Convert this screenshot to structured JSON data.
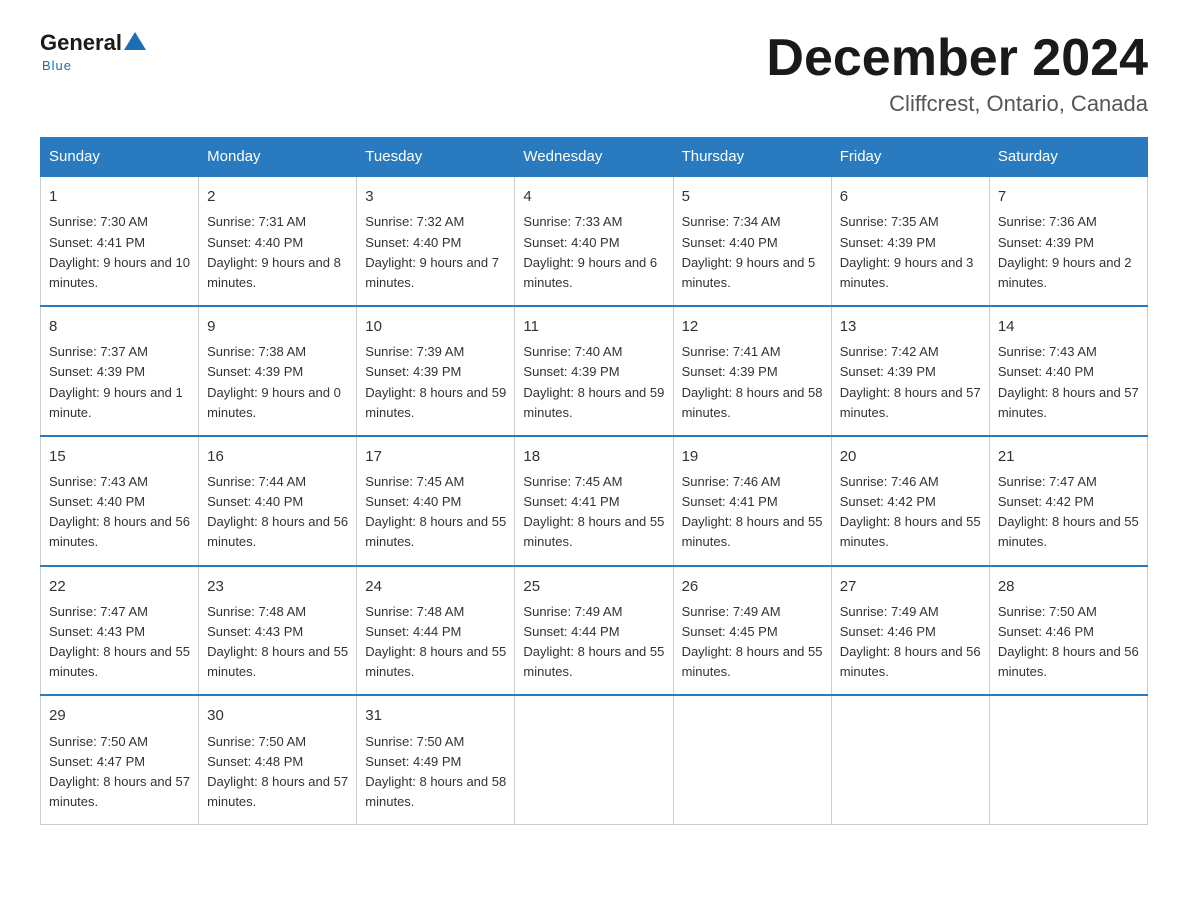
{
  "logo": {
    "general": "General",
    "blue": "Blue",
    "underline": "Blue"
  },
  "title": "December 2024",
  "subtitle": "Cliffcrest, Ontario, Canada",
  "days_of_week": [
    "Sunday",
    "Monday",
    "Tuesday",
    "Wednesday",
    "Thursday",
    "Friday",
    "Saturday"
  ],
  "weeks": [
    [
      {
        "day": "1",
        "sunrise": "7:30 AM",
        "sunset": "4:41 PM",
        "daylight": "9 hours and 10 minutes."
      },
      {
        "day": "2",
        "sunrise": "7:31 AM",
        "sunset": "4:40 PM",
        "daylight": "9 hours and 8 minutes."
      },
      {
        "day": "3",
        "sunrise": "7:32 AM",
        "sunset": "4:40 PM",
        "daylight": "9 hours and 7 minutes."
      },
      {
        "day": "4",
        "sunrise": "7:33 AM",
        "sunset": "4:40 PM",
        "daylight": "9 hours and 6 minutes."
      },
      {
        "day": "5",
        "sunrise": "7:34 AM",
        "sunset": "4:40 PM",
        "daylight": "9 hours and 5 minutes."
      },
      {
        "day": "6",
        "sunrise": "7:35 AM",
        "sunset": "4:39 PM",
        "daylight": "9 hours and 3 minutes."
      },
      {
        "day": "7",
        "sunrise": "7:36 AM",
        "sunset": "4:39 PM",
        "daylight": "9 hours and 2 minutes."
      }
    ],
    [
      {
        "day": "8",
        "sunrise": "7:37 AM",
        "sunset": "4:39 PM",
        "daylight": "9 hours and 1 minute."
      },
      {
        "day": "9",
        "sunrise": "7:38 AM",
        "sunset": "4:39 PM",
        "daylight": "9 hours and 0 minutes."
      },
      {
        "day": "10",
        "sunrise": "7:39 AM",
        "sunset": "4:39 PM",
        "daylight": "8 hours and 59 minutes."
      },
      {
        "day": "11",
        "sunrise": "7:40 AM",
        "sunset": "4:39 PM",
        "daylight": "8 hours and 59 minutes."
      },
      {
        "day": "12",
        "sunrise": "7:41 AM",
        "sunset": "4:39 PM",
        "daylight": "8 hours and 58 minutes."
      },
      {
        "day": "13",
        "sunrise": "7:42 AM",
        "sunset": "4:39 PM",
        "daylight": "8 hours and 57 minutes."
      },
      {
        "day": "14",
        "sunrise": "7:43 AM",
        "sunset": "4:40 PM",
        "daylight": "8 hours and 57 minutes."
      }
    ],
    [
      {
        "day": "15",
        "sunrise": "7:43 AM",
        "sunset": "4:40 PM",
        "daylight": "8 hours and 56 minutes."
      },
      {
        "day": "16",
        "sunrise": "7:44 AM",
        "sunset": "4:40 PM",
        "daylight": "8 hours and 56 minutes."
      },
      {
        "day": "17",
        "sunrise": "7:45 AM",
        "sunset": "4:40 PM",
        "daylight": "8 hours and 55 minutes."
      },
      {
        "day": "18",
        "sunrise": "7:45 AM",
        "sunset": "4:41 PM",
        "daylight": "8 hours and 55 minutes."
      },
      {
        "day": "19",
        "sunrise": "7:46 AM",
        "sunset": "4:41 PM",
        "daylight": "8 hours and 55 minutes."
      },
      {
        "day": "20",
        "sunrise": "7:46 AM",
        "sunset": "4:42 PM",
        "daylight": "8 hours and 55 minutes."
      },
      {
        "day": "21",
        "sunrise": "7:47 AM",
        "sunset": "4:42 PM",
        "daylight": "8 hours and 55 minutes."
      }
    ],
    [
      {
        "day": "22",
        "sunrise": "7:47 AM",
        "sunset": "4:43 PM",
        "daylight": "8 hours and 55 minutes."
      },
      {
        "day": "23",
        "sunrise": "7:48 AM",
        "sunset": "4:43 PM",
        "daylight": "8 hours and 55 minutes."
      },
      {
        "day": "24",
        "sunrise": "7:48 AM",
        "sunset": "4:44 PM",
        "daylight": "8 hours and 55 minutes."
      },
      {
        "day": "25",
        "sunrise": "7:49 AM",
        "sunset": "4:44 PM",
        "daylight": "8 hours and 55 minutes."
      },
      {
        "day": "26",
        "sunrise": "7:49 AM",
        "sunset": "4:45 PM",
        "daylight": "8 hours and 55 minutes."
      },
      {
        "day": "27",
        "sunrise": "7:49 AM",
        "sunset": "4:46 PM",
        "daylight": "8 hours and 56 minutes."
      },
      {
        "day": "28",
        "sunrise": "7:50 AM",
        "sunset": "4:46 PM",
        "daylight": "8 hours and 56 minutes."
      }
    ],
    [
      {
        "day": "29",
        "sunrise": "7:50 AM",
        "sunset": "4:47 PM",
        "daylight": "8 hours and 57 minutes."
      },
      {
        "day": "30",
        "sunrise": "7:50 AM",
        "sunset": "4:48 PM",
        "daylight": "8 hours and 57 minutes."
      },
      {
        "day": "31",
        "sunrise": "7:50 AM",
        "sunset": "4:49 PM",
        "daylight": "8 hours and 58 minutes."
      },
      null,
      null,
      null,
      null
    ]
  ],
  "labels": {
    "sunrise": "Sunrise:",
    "sunset": "Sunset:",
    "daylight": "Daylight:"
  }
}
